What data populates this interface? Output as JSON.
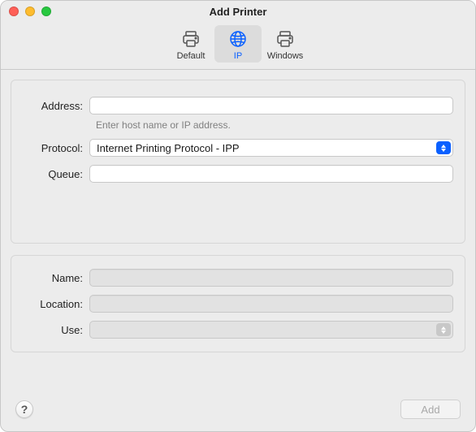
{
  "window": {
    "title": "Add Printer"
  },
  "tabs": {
    "default": "Default",
    "ip": "IP",
    "windows": "Windows",
    "active": "ip"
  },
  "form": {
    "address": {
      "label": "Address:",
      "value": "",
      "hint": "Enter host name or IP address."
    },
    "protocol": {
      "label": "Protocol:",
      "value": "Internet Printing Protocol - IPP"
    },
    "queue": {
      "label": "Queue:",
      "value": ""
    },
    "name": {
      "label": "Name:",
      "value": ""
    },
    "location": {
      "label": "Location:",
      "value": ""
    },
    "use": {
      "label": "Use:",
      "value": ""
    }
  },
  "footer": {
    "help": "?",
    "add": "Add"
  }
}
